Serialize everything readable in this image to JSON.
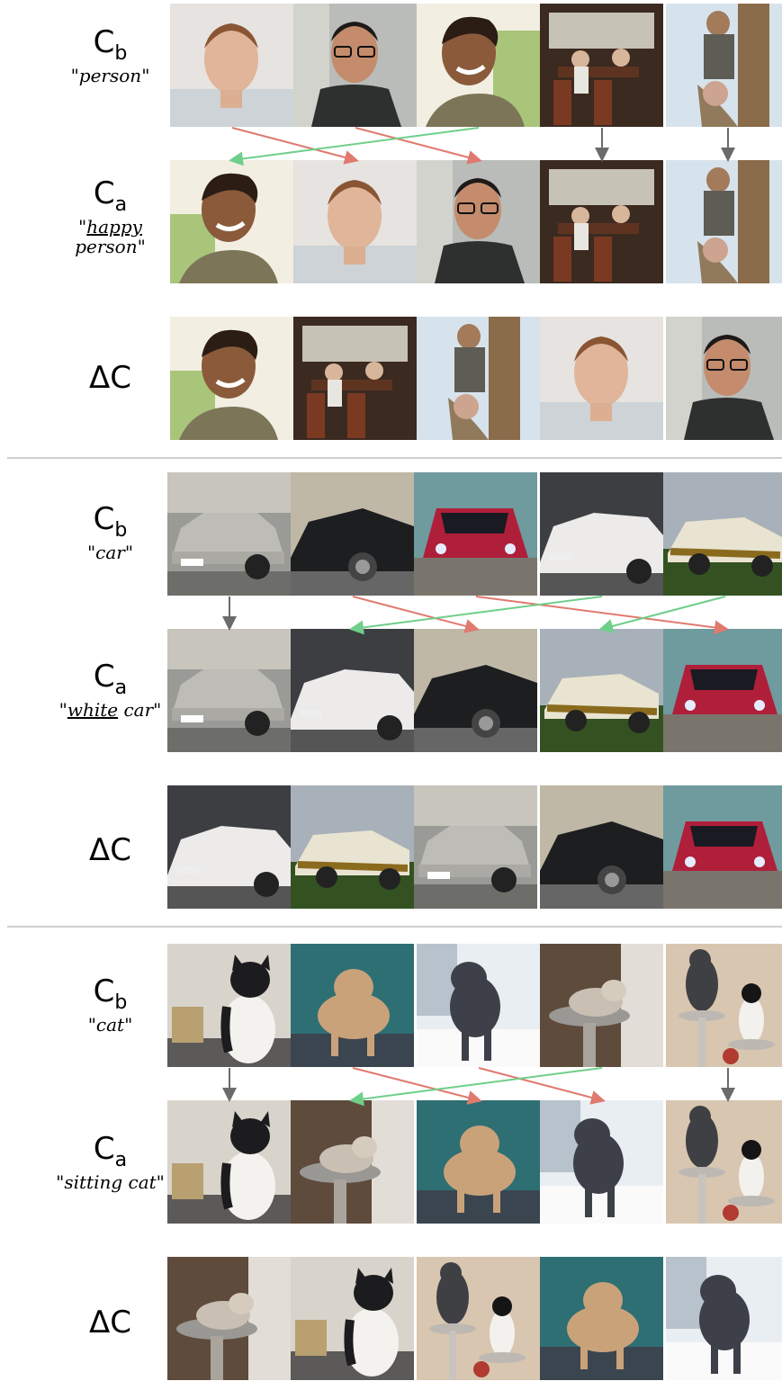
{
  "sections": [
    {
      "id": "person",
      "cb_label": "C",
      "cb_sub": "b",
      "cb_prompt_open": "\"",
      "cb_prompt_word": "person",
      "cb_prompt_close": "\"",
      "ca_label": "C",
      "ca_sub": "a",
      "ca_prompt_open": "\"",
      "ca_prompt_u": "happy",
      "ca_prompt_rest": "person",
      "ca_prompt_close": "\"",
      "delta_label": "ΔC"
    },
    {
      "id": "car",
      "cb_label": "C",
      "cb_sub": "b",
      "cb_prompt_open": "\"",
      "cb_prompt_word": "car",
      "cb_prompt_close": "\"",
      "ca_label": "C",
      "ca_sub": "a",
      "ca_prompt_open": "\"",
      "ca_prompt_u": "white",
      "ca_prompt_rest": " car",
      "ca_prompt_close": "\"",
      "delta_label": "ΔC"
    },
    {
      "id": "cat",
      "cb_label": "C",
      "cb_sub": "b",
      "cb_prompt_open": "\"",
      "cb_prompt_word": "cat",
      "cb_prompt_close": "\"",
      "ca_label": "C",
      "ca_sub": "a",
      "ca_prompt_open": "\"",
      "ca_prompt_u": "",
      "ca_prompt_rest": "sitting cat",
      "ca_prompt_close": "\"",
      "delta_label": "ΔC"
    }
  ],
  "colors": {
    "arrow_down": "#6b6b6b",
    "arrow_red": "#e07a6f",
    "arrow_green": "#6fcf8a",
    "separator": "#cfcfcf"
  },
  "images": {
    "person": {
      "cb": [
        "man-short-hair-portrait",
        "man-glasses-apron",
        "smiling-woman-outdoors",
        "restaurant-interior",
        "climber-on-pole"
      ],
      "ca": [
        "smiling-woman-outdoors",
        "man-short-hair-portrait",
        "man-glasses-apron",
        "restaurant-interior",
        "climber-on-pole"
      ],
      "delta": [
        "smiling-woman-outdoors",
        "restaurant-interior",
        "climber-on-pole",
        "man-short-hair-portrait",
        "man-glasses-apron"
      ]
    },
    "car": {
      "cb": [
        "silver-hatchback",
        "black-sedan",
        "red-drifting-car",
        "white-skyline",
        "white-gold-classic"
      ],
      "ca": [
        "silver-hatchback",
        "white-skyline",
        "black-sedan",
        "white-gold-classic",
        "red-drifting-car"
      ],
      "delta": [
        "white-skyline",
        "white-gold-classic",
        "silver-hatchback",
        "black-sedan",
        "red-drifting-car"
      ]
    },
    "cat": {
      "cb": [
        "black-white-cat-sitting",
        "orange-cat-standing",
        "gray-cat-standing",
        "cat-on-scratch-post",
        "two-cats-on-tree"
      ],
      "ca": [
        "black-white-cat-sitting",
        "cat-on-scratch-post",
        "orange-cat-standing",
        "gray-cat-standing",
        "two-cats-on-tree"
      ],
      "delta": [
        "cat-on-scratch-post",
        "black-white-cat-sitting",
        "two-cats-on-tree",
        "orange-cat-standing",
        "gray-cat-standing"
      ]
    }
  }
}
